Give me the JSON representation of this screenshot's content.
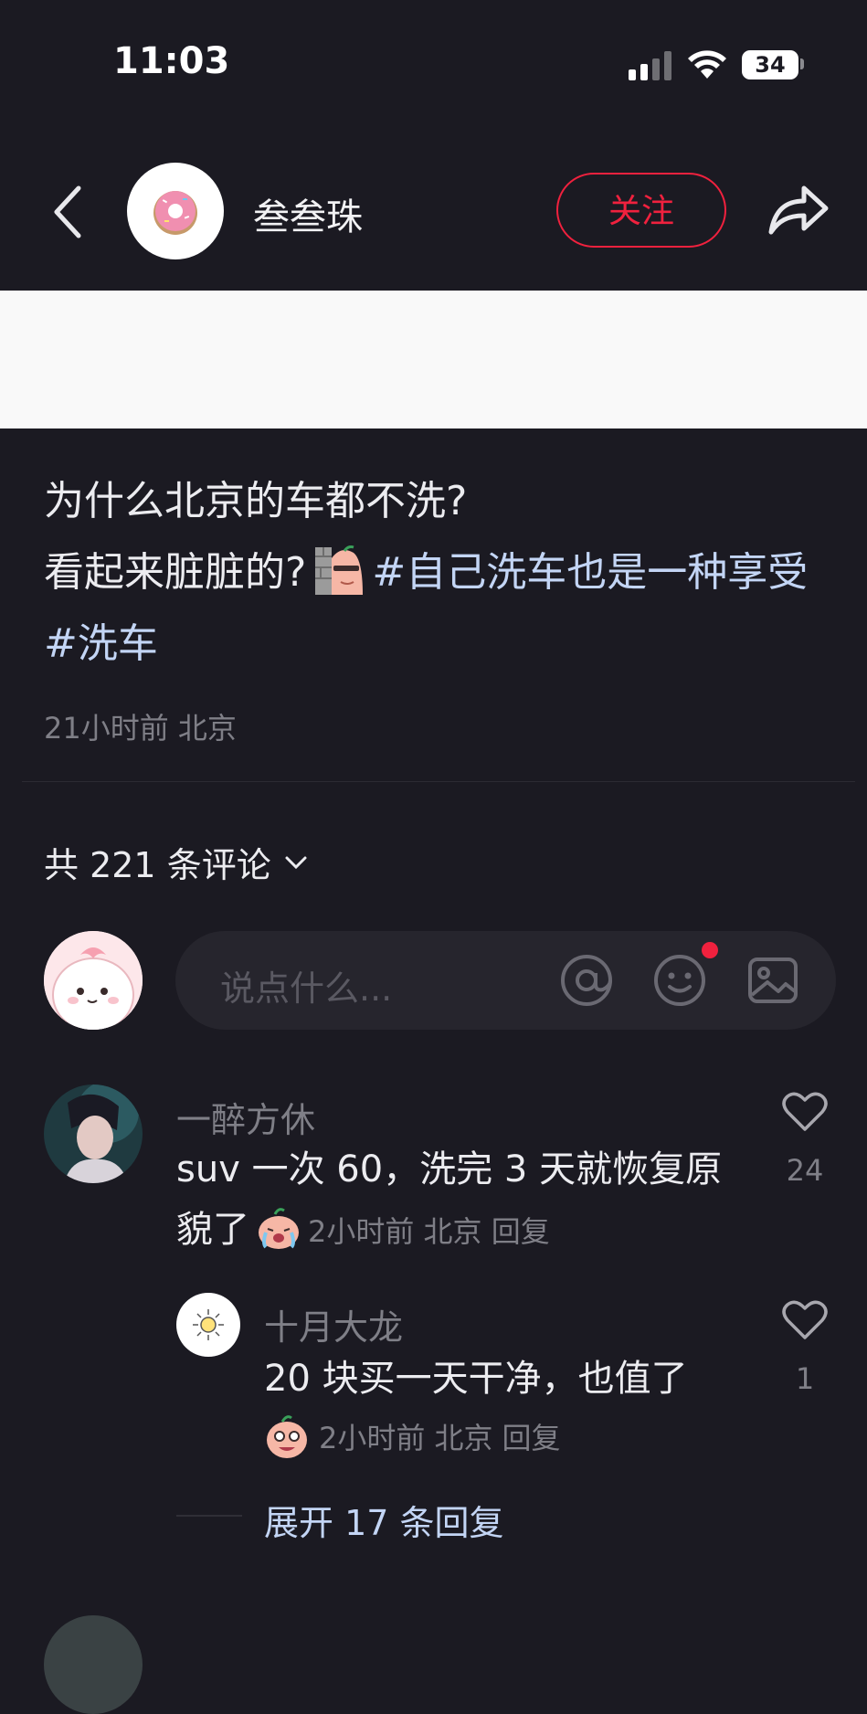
{
  "status_bar": {
    "time": "11:03",
    "battery": "34"
  },
  "header": {
    "author_name": "叁叁珠",
    "follow_label": "关注"
  },
  "post": {
    "line1": "为什么北京的车都不洗?",
    "line2": "看起来脏脏的?",
    "tag1": "#自己洗车也是一种享受",
    "tag2": "#洗车",
    "meta": "21小时前 北京"
  },
  "comments_header": {
    "count_label": "共 221 条评论"
  },
  "comment_input": {
    "placeholder": "说点什么..."
  },
  "comments": [
    {
      "user": "一醉方休",
      "text": "suv 一次 60，洗完 3 天就恢复原貌了",
      "time_location": "2小时前 北京",
      "reply_label": "回复",
      "likes": "24",
      "replies": [
        {
          "user": "十月大龙",
          "text": "20 块买一天干净，也值了",
          "time_location": "2小时前 北京",
          "reply_label": "回复",
          "likes": "1"
        }
      ],
      "expand_label": "展开 17 条回复"
    }
  ],
  "colors": {
    "background": "#1b1a22",
    "accent_red": "#f0213e",
    "tag_blue": "#c3d5f5",
    "muted": "#7f7f87"
  },
  "icons": [
    "back-icon",
    "share-icon",
    "at-icon",
    "emoji-icon",
    "image-icon",
    "heart-icon",
    "chevron-down-icon"
  ]
}
